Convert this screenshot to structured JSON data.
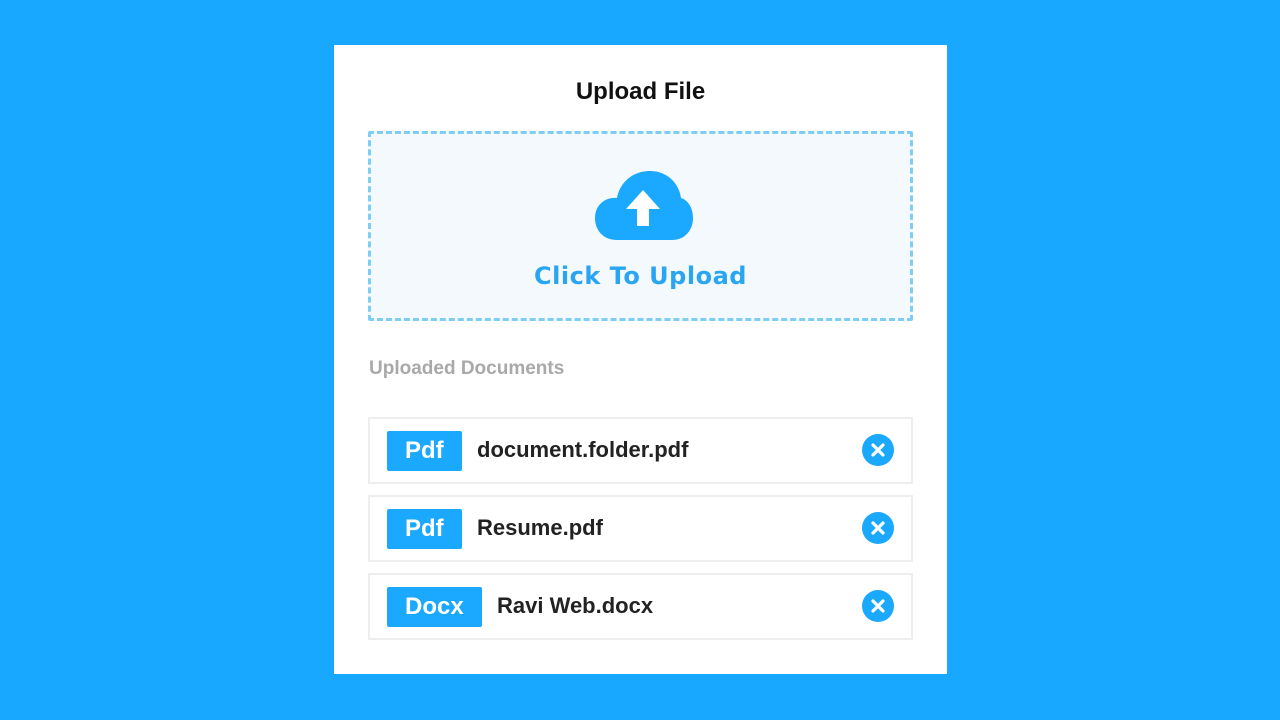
{
  "app": {
    "title": "Upload File"
  },
  "dropzone": {
    "label": "Click To Upload",
    "icon": "cloud-upload-icon"
  },
  "documents": {
    "section_label": "Uploaded Documents",
    "items": [
      {
        "type": "Pdf",
        "name": "document.folder.pdf",
        "remove_icon": "close-icon"
      },
      {
        "type": "Pdf",
        "name": "Resume.pdf",
        "remove_icon": "close-icon"
      },
      {
        "type": "Docx",
        "name": "Ravi Web.docx",
        "remove_icon": "close-icon"
      }
    ]
  },
  "colors": {
    "page_background": "#18a8ff",
    "accent": "#1ba8ff",
    "dropzone_border": "#7fcdf3",
    "dropzone_background": "#f3f9fd",
    "muted_text": "#a9a9a9"
  }
}
